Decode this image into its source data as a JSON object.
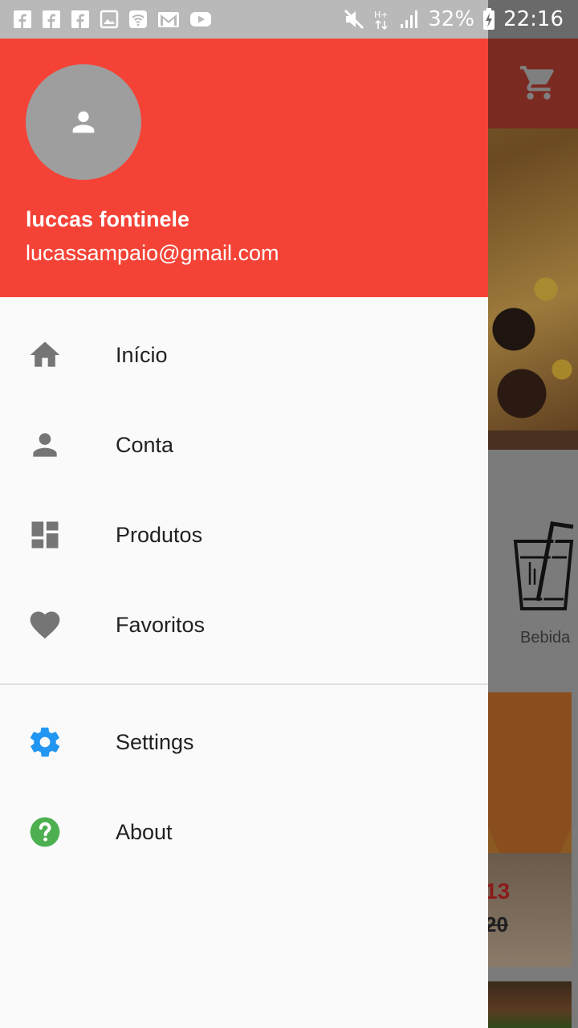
{
  "status_bar": {
    "left_icons": [
      "facebook-icon",
      "facebook-icon",
      "facebook-icon",
      "image-icon",
      "wifi-icon",
      "gmail-icon",
      "youtube-icon"
    ],
    "right_icons": [
      "mute-icon",
      "hplus-signal-icon",
      "cell-signal-icon",
      "battery-charging-icon"
    ],
    "battery_percent": "32%",
    "time": "22:16"
  },
  "drawer": {
    "header": {
      "user_name": "luccas fontinele",
      "user_email": "lucassampaio@gmail.com",
      "background_color": "#f44336"
    },
    "items": [
      {
        "label": "Início",
        "icon": "home-icon"
      },
      {
        "label": "Conta",
        "icon": "person-icon"
      },
      {
        "label": "Produtos",
        "icon": "dashboard-icon"
      },
      {
        "label": "Favoritos",
        "icon": "heart-icon"
      }
    ],
    "secondary_items": [
      {
        "label": "Settings",
        "icon": "gear-icon",
        "color": "#2196f3"
      },
      {
        "label": "About",
        "icon": "help-circle-icon",
        "color": "#4caf50"
      }
    ]
  },
  "background_app": {
    "cart_icon": "cart-icon",
    "category_label": "Bebida",
    "price_current": "13",
    "price_old": "20"
  }
}
